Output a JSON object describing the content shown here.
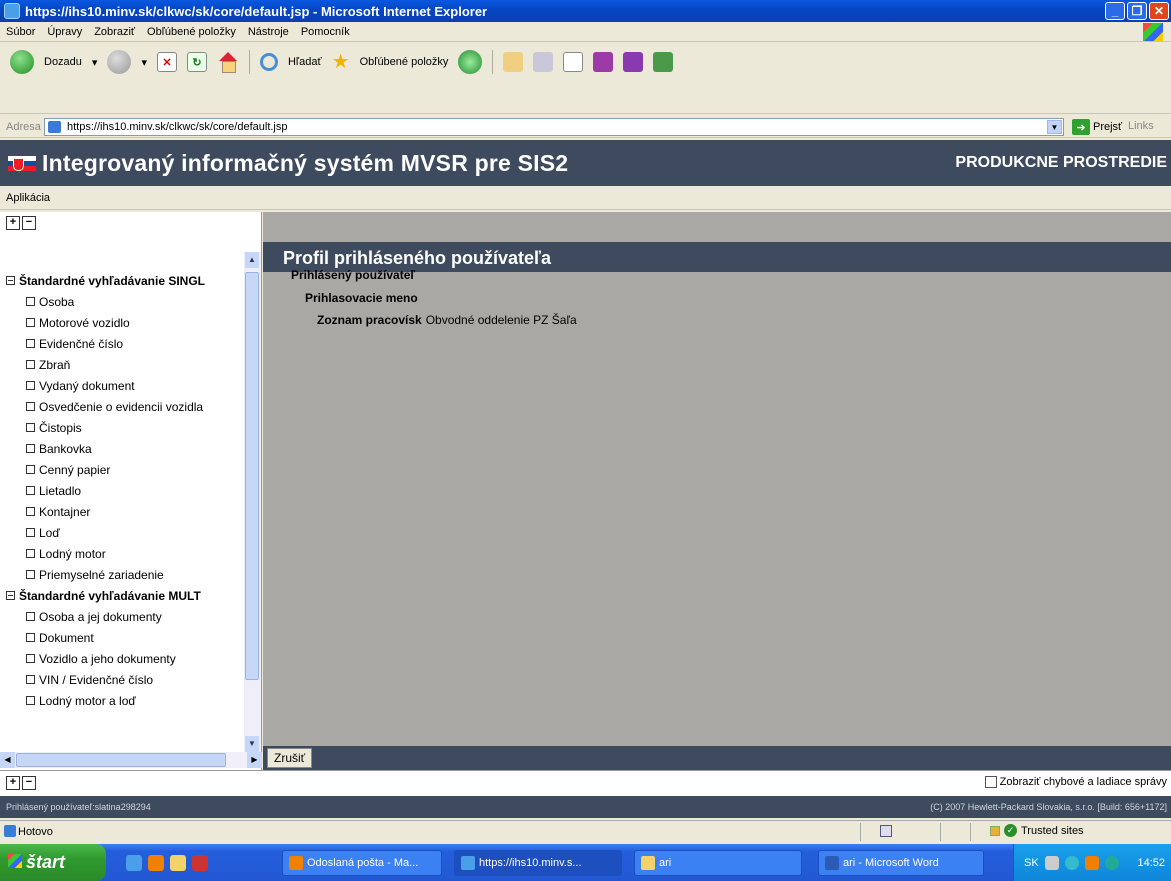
{
  "window": {
    "title": "https://ihs10.minv.sk/clkwc/sk/core/default.jsp - Microsoft Internet Explorer"
  },
  "menu": [
    "Súbor",
    "Úpravy",
    "Zobraziť",
    "Obľúbené položky",
    "Nástroje",
    "Pomocník"
  ],
  "toolbar": {
    "back_label": "Dozadu",
    "search_label": "Hľadať",
    "favorites_label": "Obľúbené položky"
  },
  "address": {
    "label": "Adresa",
    "url": "https://ihs10.minv.sk/clkwc/sk/core/default.jsp",
    "go_label": "Prejsť",
    "links_label": "Links"
  },
  "app": {
    "title": "Integrovaný informačný systém MVSR pre SIS2",
    "environment": "PRODUKCNE PROSTREDIE",
    "menu_label": "Aplikácia"
  },
  "tree": {
    "groups": [
      {
        "label": "Štandardné vyhľadávanie SINGL",
        "items": [
          "Osoba",
          "Motorové vozidlo",
          "Evidenčné číslo",
          "Zbraň",
          "Vydaný dokument",
          "Osvedčenie o evidencii vozidla",
          "Čistopis",
          "Bankovka",
          "Cenný papier",
          "Lietadlo",
          "Kontajner",
          "Loď",
          "Lodný motor",
          "Priemyselné zariadenie"
        ]
      },
      {
        "label": "Štandardné vyhľadávanie MULT",
        "items": [
          "Osoba a jej dokumenty",
          "Dokument",
          "Vozidlo a jeho dokumenty",
          "VIN / Evidenčné číslo",
          "Lodný motor a loď"
        ]
      }
    ]
  },
  "profile": {
    "header": "Profil prihláseného používateľa",
    "logged_user_label": "Prihlásený používateľ",
    "login_name_label": "Prihlasovacie meno",
    "workplaces_label": "Zoznam pracovísk",
    "workplaces_value": "Obvodné oddelenie PZ Šaľa",
    "cancel_label": "Zrušiť"
  },
  "lower": {
    "debug_checkbox_label": "Zobraziť chybové a ladiace správy"
  },
  "app_status": {
    "user": "Prihlásený používateľ:slatina298294",
    "copyright": "(C) 2007 Hewlett-Packard Slovakia, s.r.o. [Build: 656+1172]"
  },
  "ie_status": {
    "text": "Hotovo",
    "zone": "Trusted sites"
  },
  "taskbar": {
    "start_label": "štart",
    "tasks": [
      "Odoslaná pošta - Ma...",
      "https://ihs10.minv.s...",
      "ari",
      "ari - Microsoft Word"
    ],
    "lang": "SK",
    "clock": "14:52"
  }
}
